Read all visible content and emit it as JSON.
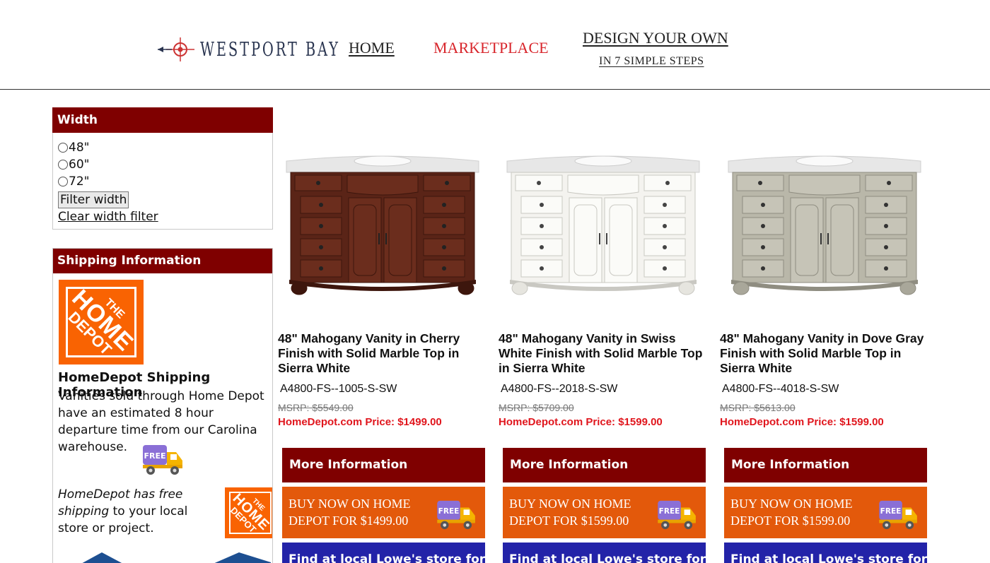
{
  "header": {
    "logo_text": "WESTPORT BAY",
    "nav": {
      "home": "HOME",
      "marketplace": "MARKETPLACE",
      "design": "DESIGN YOUR OWN",
      "design_sub": "IN 7 SIMPLE STEPS"
    }
  },
  "colors": {
    "brand_red": "#7f0000",
    "home_depot_orange": "#e3590b",
    "lowes_blue": "#2323a8",
    "price_red": "#e0161d",
    "nav_active": "#d8262c"
  },
  "sidebar": {
    "width_filter": {
      "heading": "Width",
      "options": [
        "48\"",
        "60\"",
        "72\""
      ],
      "filter_button": "Filter width",
      "clear_link": "Clear width filter"
    },
    "shipping": {
      "heading": "Shipping Information",
      "logo_line1": "THE",
      "logo_line2": "HOME",
      "logo_line3": "DEPOT",
      "title": "HomeDepot Shipping Information",
      "body": "Vanities sold through Home Depot have an estimated 8 hour departure time from our Carolina warehouse.",
      "free_label": "FREE",
      "free_shipping_italic": "HomeDepot has free shipping",
      "free_shipping_rest": " to your local store or project."
    }
  },
  "products": [
    {
      "title": "48\" Mahogany Vanity in Cherry Finish with Solid Marble Top in Sierra White",
      "sku": "A4800-FS--1005-S-SW",
      "msrp": "MSRP: $5549.00",
      "price": "HomeDepot.com Price: $1499.00",
      "more": "More Information",
      "buy": "BUY NOW ON HOME DEPOT FOR $1499.00",
      "lowes": "Find at local Lowe's store for",
      "finish": "cherry"
    },
    {
      "title": "48\" Mahogany Vanity in Swiss White Finish with Solid Marble Top in Sierra White",
      "sku": "A4800-FS--2018-S-SW",
      "msrp": "MSRP: $5709.00",
      "price": "HomeDepot.com Price: $1599.00",
      "more": "More Information",
      "buy": "BUY NOW ON HOME DEPOT FOR $1599.00",
      "lowes": "Find at local Lowe's store for",
      "finish": "white"
    },
    {
      "title": "48\" Mahogany Vanity in Dove Gray Finish with Solid Marble Top in Sierra White",
      "sku": "A4800-FS--4018-S-SW",
      "msrp": "MSRP: $5613.00",
      "price": "HomeDepot.com Price: $1599.00",
      "more": "More Information",
      "buy": "BUY NOW ON HOME DEPOT FOR $1599.00",
      "lowes": "Find at local Lowe's store for",
      "finish": "gray"
    }
  ],
  "icons": {
    "logo": "crosshair-compass-icon",
    "truck": "free-shipping-truck-icon",
    "radio": "radio-button-icon"
  }
}
